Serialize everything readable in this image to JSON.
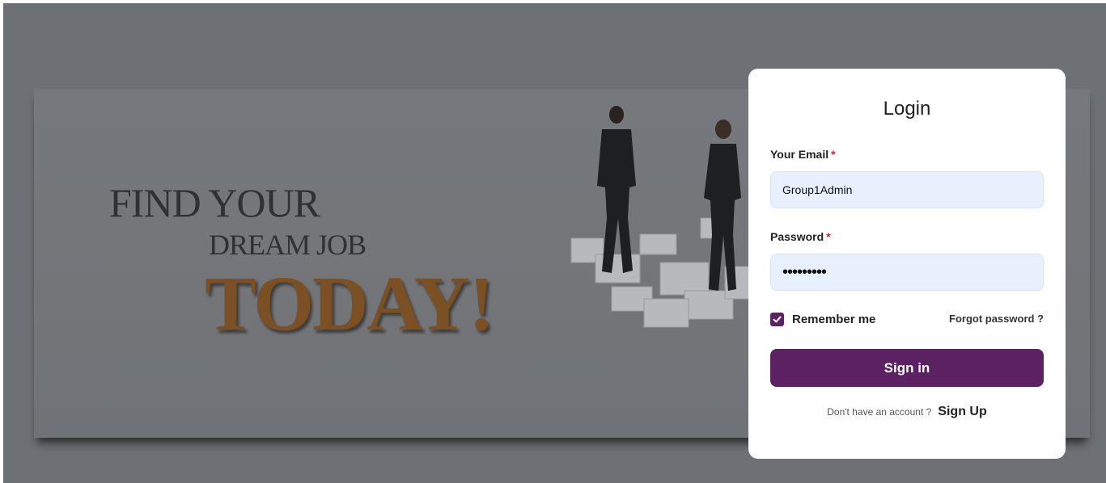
{
  "banner": {
    "line1": "FIND YOUR",
    "line2": "DREAM JOB",
    "line3": "TODAY!"
  },
  "login": {
    "title": "Login",
    "email_label": "Your Email",
    "email_value": "Group1Admin",
    "password_label": "Password",
    "password_value": "•••••••••",
    "required_mark": "*",
    "remember_label": "Remember me",
    "remember_checked": true,
    "forgot_label": "Forgot password ?",
    "signin_label": "Sign in",
    "no_account_text": "Don't have an account ?",
    "signup_label": "Sign Up"
  },
  "colors": {
    "accent": "#5c2162",
    "input_bg": "#e8f0fe",
    "overlay": "#6d7074",
    "today_text": "#7b5024"
  }
}
